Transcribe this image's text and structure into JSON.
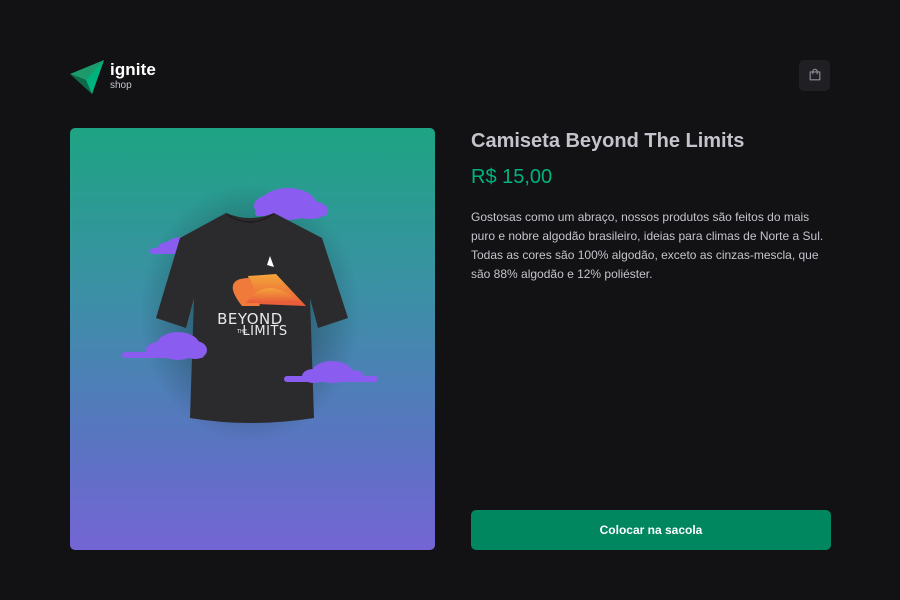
{
  "brand": {
    "name": "ignite",
    "tagline": "shop",
    "icon": "ignite-logo-icon",
    "accent_color": "#00875f"
  },
  "header": {
    "cart_icon": "shopping-bag-icon"
  },
  "product": {
    "title": "Camiseta Beyond The Limits",
    "price": "R$ 15,00",
    "description": "Gostosas como um abraço, nossos produtos são feitos do mais puro e nobre algodão brasileiro, ideias para climas de Norte a Sul. Todas as cores são 100% algodão, exceto as cinzas-mescla, que são 88% algodão e 12% poliéster.",
    "image_text": {
      "line1": "BEYOND",
      "line2_small": "THE",
      "line2": "LIMITS"
    },
    "price_color": "#00b37e"
  },
  "actions": {
    "add_to_bag_label": "Colocar na sacola"
  }
}
